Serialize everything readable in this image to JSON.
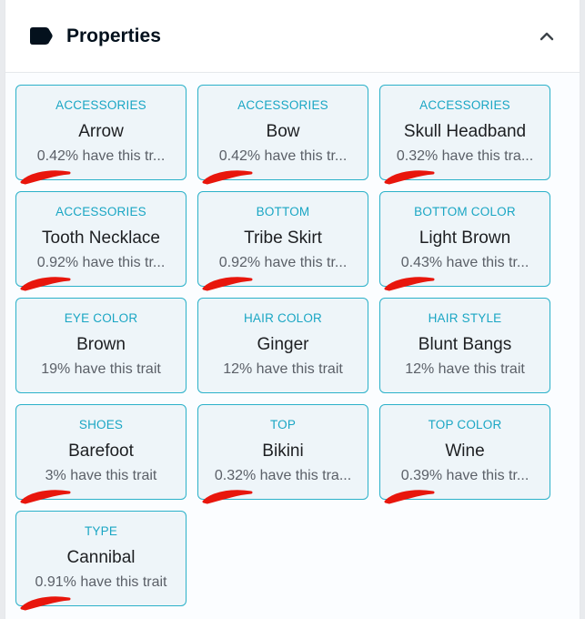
{
  "header": {
    "title": "Properties",
    "icon": "tag-icon",
    "collapse_icon": "chevron-up-icon"
  },
  "colors": {
    "accent": "#2bb1c9",
    "type_text": "#1aa6c4",
    "card_bg": "#eef5f9",
    "redaction": "#e8160c"
  },
  "traits": [
    {
      "type": "ACCESSORIES",
      "value": "Arrow",
      "rarity": "0.42% have this tr..."
    },
    {
      "type": "ACCESSORIES",
      "value": "Bow",
      "rarity": "0.42% have this tr..."
    },
    {
      "type": "ACCESSORIES",
      "value": "Skull Headband",
      "rarity": "0.32% have this tra..."
    },
    {
      "type": "ACCESSORIES",
      "value": "Tooth Necklace",
      "rarity": "0.92% have this tr..."
    },
    {
      "type": "BOTTOM",
      "value": "Tribe Skirt",
      "rarity": "0.92% have this tr..."
    },
    {
      "type": "BOTTOM COLOR",
      "value": "Light Brown",
      "rarity": "0.43% have this tr..."
    },
    {
      "type": "EYE COLOR",
      "value": "Brown",
      "rarity": "19% have this trait"
    },
    {
      "type": "HAIR COLOR",
      "value": "Ginger",
      "rarity": "12% have this trait"
    },
    {
      "type": "HAIR STYLE",
      "value": "Blunt Bangs",
      "rarity": "12% have this trait"
    },
    {
      "type": "SHOES",
      "value": "Barefoot",
      "rarity": "3% have this trait"
    },
    {
      "type": "TOP",
      "value": "Bikini",
      "rarity": "0.32% have this tra..."
    },
    {
      "type": "TOP COLOR",
      "value": "Wine",
      "rarity": "0.39% have this tr..."
    },
    {
      "type": "TYPE",
      "value": "Cannibal",
      "rarity": "0.91% have this trait"
    }
  ]
}
